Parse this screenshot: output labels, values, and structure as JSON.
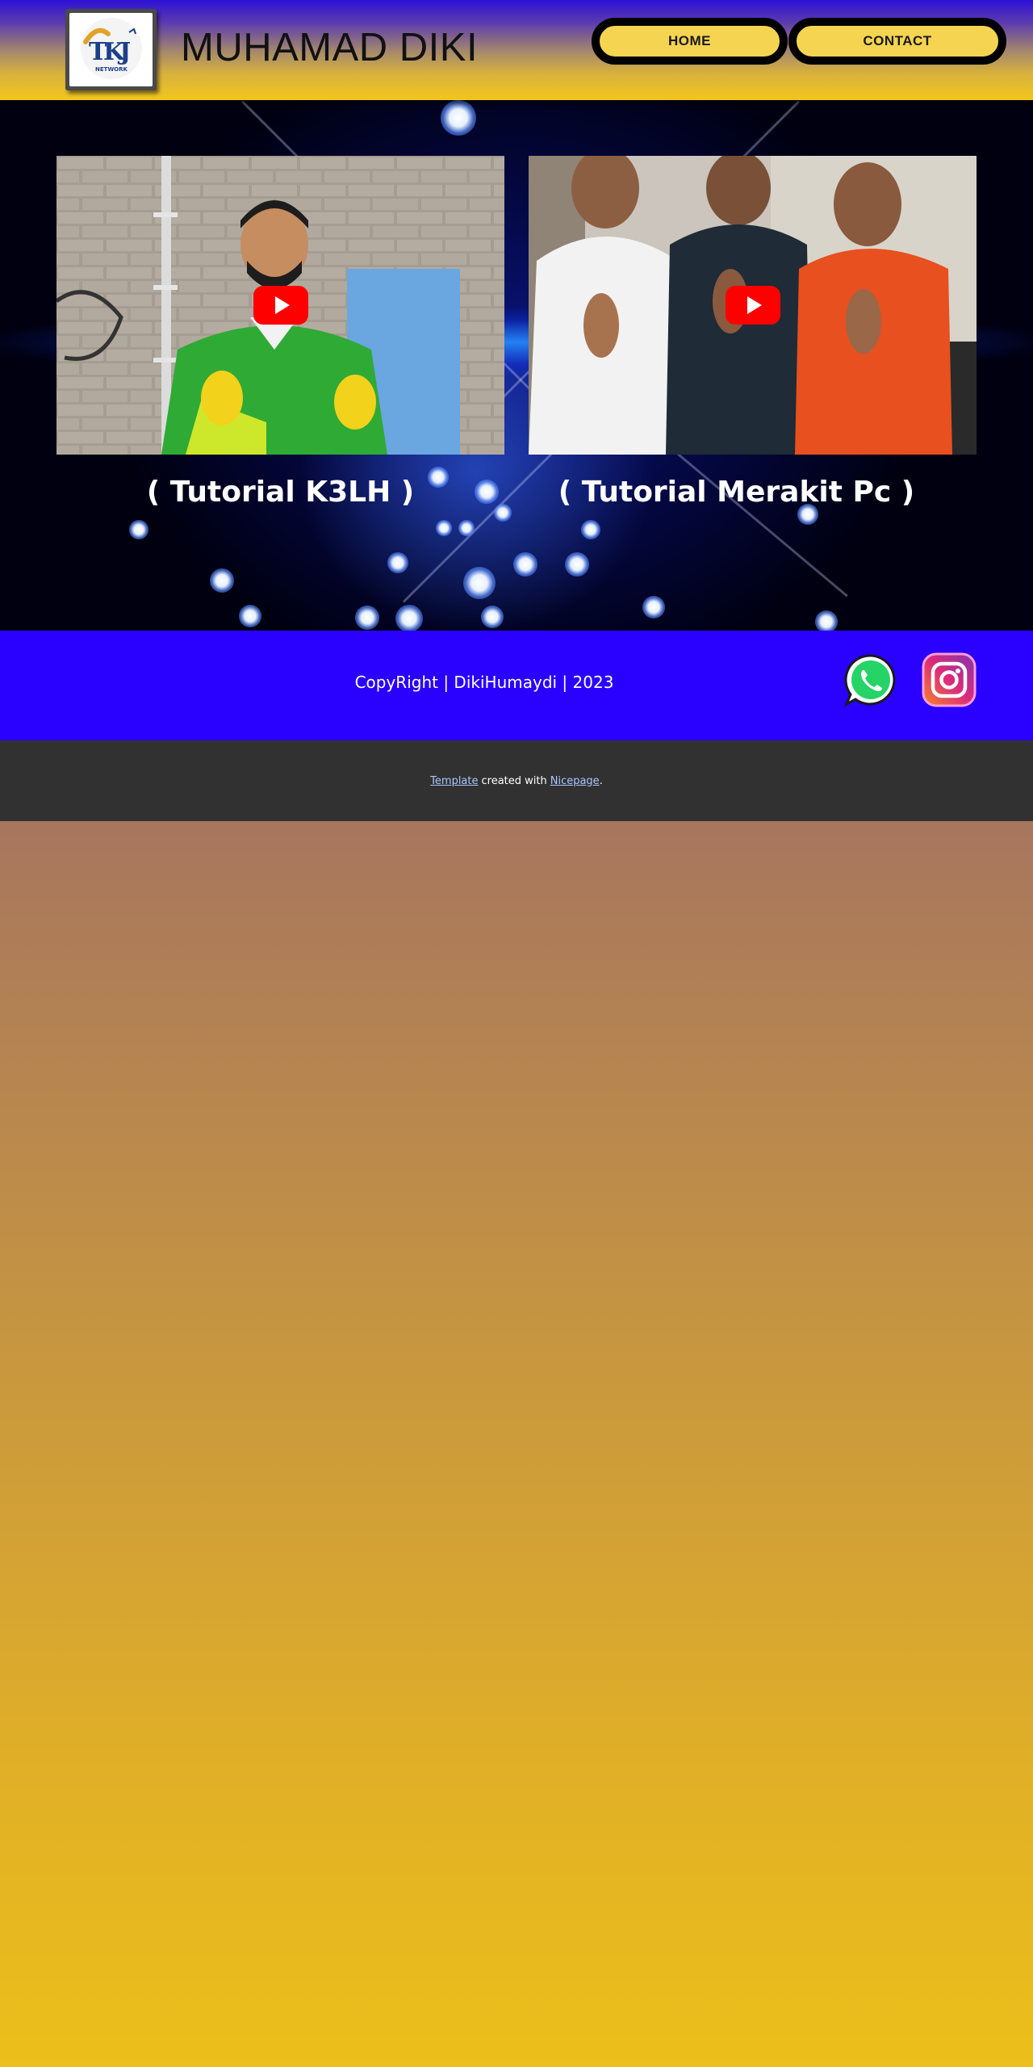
{
  "header": {
    "title": "MUHAMAD DIKI",
    "logo_text": "NETWORK",
    "nav": [
      {
        "label": "HOME"
      },
      {
        "label": "CONTACT"
      }
    ]
  },
  "hero": {
    "videos": [
      {
        "caption": "( Tutorial K3LH )",
        "icon": "play-icon"
      },
      {
        "caption": "( Tutorial Merakit Pc )",
        "icon": "play-icon"
      }
    ]
  },
  "footer": {
    "copyright": "CopyRight | DikiHumaydi | 2023",
    "social": [
      {
        "name": "whatsapp-icon",
        "color": "#25d366"
      },
      {
        "name": "instagram-icon",
        "color": "#d6249f"
      }
    ]
  },
  "credit": {
    "template_link": "Template",
    "middle": "created with",
    "nicepage_link": "Nicepage",
    "end": "."
  },
  "colors": {
    "footer_bg": "#2a00ff",
    "nav_bg": "#f5d451",
    "credit_bg": "#313131"
  }
}
